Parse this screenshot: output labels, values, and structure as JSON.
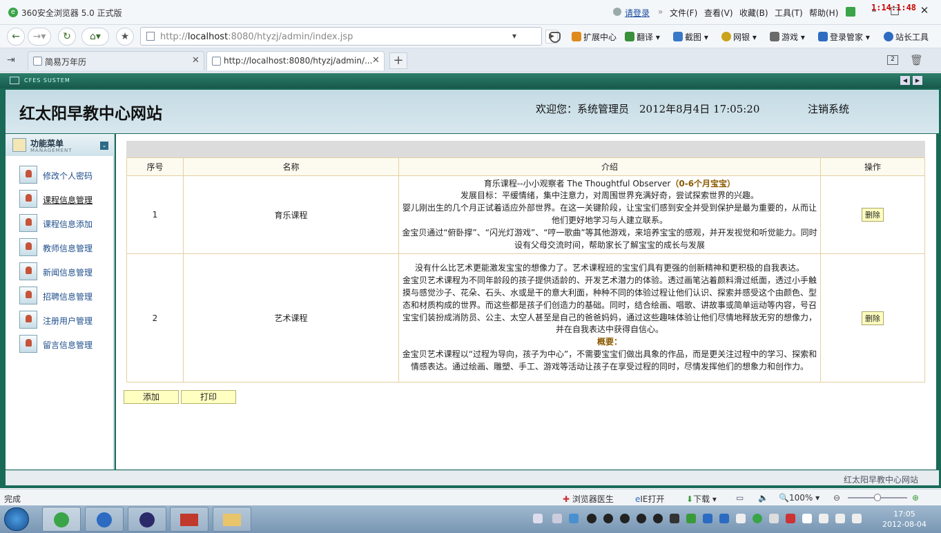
{
  "browser": {
    "app_title": "360安全浏览器 5.0 正式版",
    "login": "请登录",
    "menus": [
      "文件(F)",
      "查看(V)",
      "收藏(B)",
      "工具(T)",
      "帮助(H)"
    ],
    "clock": "1:14:1:48",
    "address_host": "http://",
    "address_bold": "localhost",
    "address_rest": ":8080/htyzj/admin/index.jsp",
    "tools": [
      "扩展中心",
      "翻译",
      "截图",
      "网银",
      "游戏",
      "登录管家",
      "站长工具"
    ],
    "tabs": [
      {
        "label": "简易万年历"
      },
      {
        "label": "http://localhost:8080/htyzj/admin/..."
      }
    ]
  },
  "page": {
    "system_label": "CFES SUSTEM",
    "site_title": "红太阳早教中心网站",
    "welcome": "欢迎您：系统管理员　2012年8月4日  17:05:20",
    "logout": "注销系统",
    "menu_title": "功能菜单",
    "menu_subtitle": "MANAGEMENT",
    "menu_items": [
      "修改个人密码",
      "课程信息管理",
      "课程信息添加",
      "教师信息管理",
      "新闻信息管理",
      "招聘信息管理",
      "注册用户管理",
      "留言信息管理"
    ],
    "table": {
      "headers": [
        "序号",
        "名称",
        "介绍",
        "操作"
      ],
      "rows": [
        {
          "no": "1",
          "name": "育乐课程",
          "intro_title": "育乐课程--小小观察者  The Thoughtful Observer",
          "intro_highlight": "（0-6个月宝宝）",
          "intro_lines": [
            "发展目标：平缓情绪，集中注意力，对周围世界充满好奇，尝试探索世界的兴趣。",
            "婴儿刚出生的几个月正试着适应外部世界。在这一关键阶段，让宝宝们感到安全并受到保护是最为重要的，从而让他们更好地学习与人建立联系。",
            "金宝贝通过“俯卧撑”、“闪光灯游戏”、“哼一歌曲”等其他游戏，来培养宝宝的感观，并开发视觉和听觉能力。同时设有父母交流时间，帮助家长了解宝宝的成长与发展"
          ],
          "action": "删除"
        },
        {
          "no": "2",
          "name": "艺术课程",
          "intro_lines": [
            "没有什么比艺术更能激发宝宝的想像力了。艺术课程班的宝宝们具有更强的创新精神和更积极的自我表达。",
            "金宝贝艺术课程为不同年龄段的孩子提供适龄的、开发艺术潜力的体验。透过画笔沾着颜料滑过纸面，透过小手触摸与感觉沙子、花朵、石头、水或是干的意大利面，种种不同的体验过程让他们认识、探索并感受这个由颜色、型态和材质构成的世界。而这些都是孩子们创造力的基础。同时，结合绘画、唱歌、讲故事或简单运动等内容，号召宝宝们装扮成消防员、公主、太空人甚至是自己的爸爸妈妈，通过这些趣味体验让他们尽情地释放无穷的想像力，并在自我表达中获得自信心。"
          ],
          "intro_highlight": "概要：",
          "intro_tail": "金宝贝艺术课程以“过程为导向，孩子为中心”，不需要宝宝们做出具象的作品，而是更关注过程中的学习、探索和情感表达。通过绘画、雕塑、手工、游戏等活动让孩子在享受过程的同时，尽情发挥他们的想象力和创作力。",
          "action": "删除"
        }
      ]
    },
    "add_button": "添加",
    "print_button": "打印",
    "footer": "红太阳早教中心网站"
  },
  "status": {
    "left": "完成",
    "doctor": "浏览器医生",
    "ie": "IE打开",
    "download": "下载",
    "zoom": "100%"
  },
  "taskbar": {
    "time": "17:05",
    "date": "2012-08-04"
  }
}
